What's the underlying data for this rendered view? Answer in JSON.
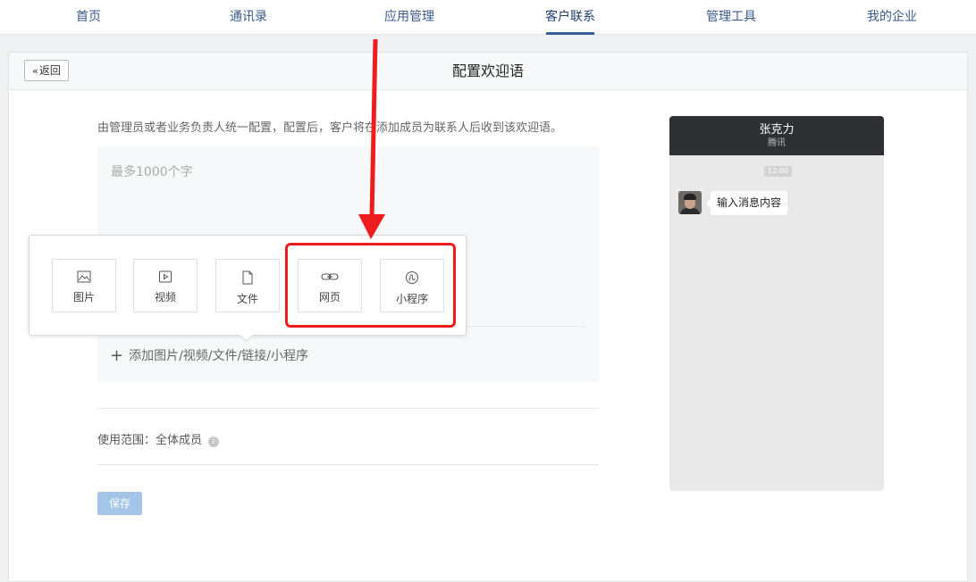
{
  "nav": {
    "items": [
      {
        "label": "首页"
      },
      {
        "label": "通讯录"
      },
      {
        "label": "应用管理"
      },
      {
        "label": "客户联系"
      },
      {
        "label": "管理工具"
      },
      {
        "label": "我的企业"
      }
    ],
    "active": "客户联系"
  },
  "header": {
    "back_label": "返回",
    "title": "配置欢迎语"
  },
  "main": {
    "description": "由管理员或者业务负责人统一配置，配置后，客户将在添加成员为联系人后收到该欢迎语。",
    "editor_placeholder": "最多1000个字",
    "add_attachment_label": "添加图片/视频/文件/链接/小程序",
    "scope_label": "使用范围：",
    "scope_value": "全体成员",
    "save_label": "保存"
  },
  "popup": {
    "options": [
      {
        "label": "图片",
        "icon": "image-icon"
      },
      {
        "label": "视频",
        "icon": "video-icon"
      },
      {
        "label": "文件",
        "icon": "file-icon"
      },
      {
        "label": "网页",
        "icon": "link-icon"
      },
      {
        "label": "小程序",
        "icon": "miniprogram-icon"
      }
    ]
  },
  "preview": {
    "contact_name": "张克力",
    "company": "腾讯",
    "time": "12:00",
    "message": "输入消息内容"
  },
  "colors": {
    "nav_text": "#3a5a8c",
    "nav_active_underline": "#3a5f99",
    "save_button": "#a3c5e8",
    "annotation_red": "#ee1c1c",
    "phone_header": "#2f3033"
  }
}
